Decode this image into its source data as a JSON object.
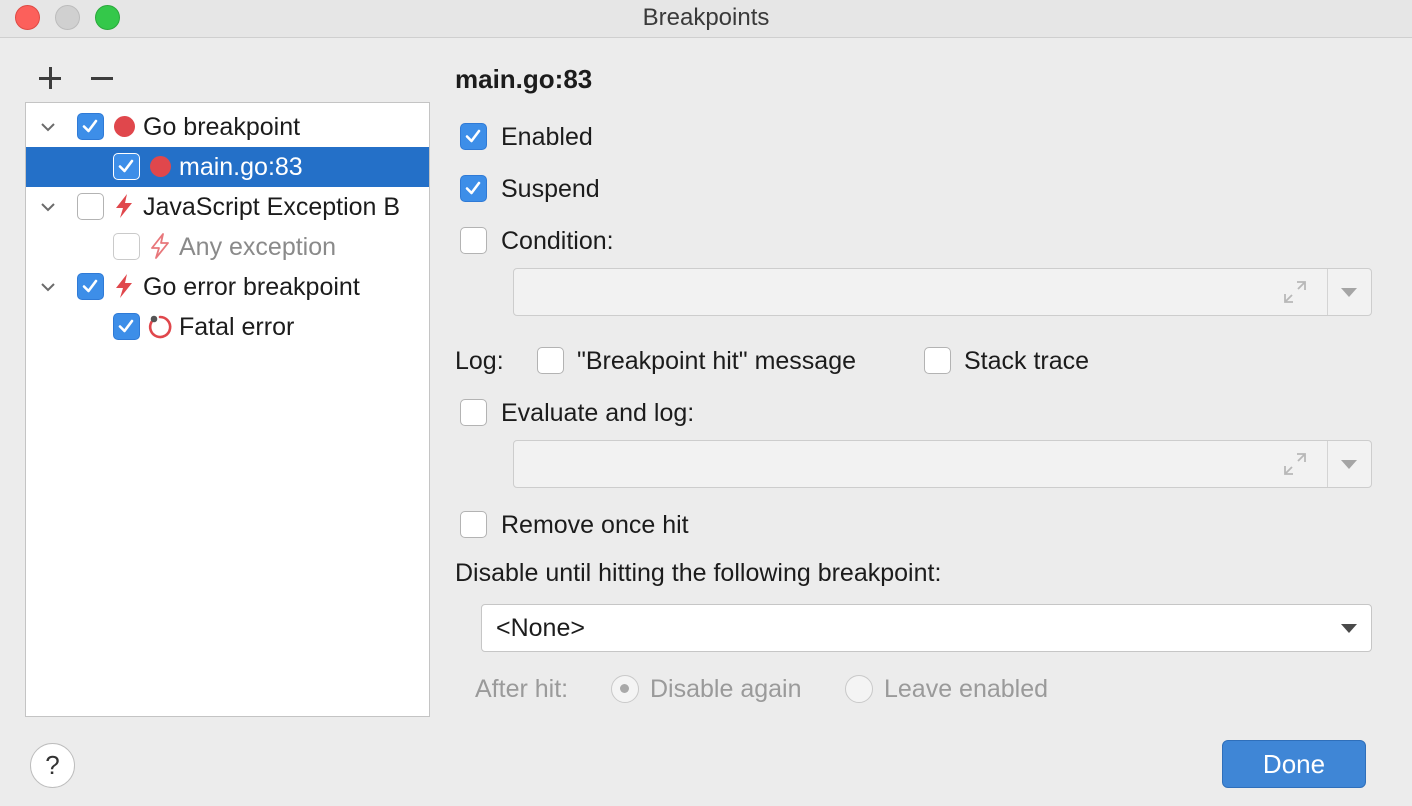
{
  "window": {
    "title": "Breakpoints"
  },
  "toolbar": {
    "add_icon": "plus-icon",
    "remove_icon": "minus-icon"
  },
  "tree": {
    "groups": [
      {
        "label": "Go breakpoint",
        "checked": true,
        "icon": "red-dot-icon",
        "expanded": true,
        "children": [
          {
            "label": "main.go:83",
            "checked": true,
            "icon": "red-dot-icon",
            "selected": true
          }
        ]
      },
      {
        "label": "JavaScript Exception B",
        "checked": false,
        "icon": "lightning-icon",
        "expanded": true,
        "children": [
          {
            "label": "Any exception",
            "checked": false,
            "icon": "lightning-icon",
            "disabled": true
          }
        ]
      },
      {
        "label": "Go error breakpoint",
        "checked": true,
        "icon": "lightning-icon",
        "expanded": true,
        "children": [
          {
            "label": "Fatal error",
            "checked": true,
            "icon": "fatal-error-icon"
          }
        ]
      }
    ]
  },
  "details": {
    "heading": "main.go:83",
    "enabled": {
      "label": "Enabled",
      "checked": true
    },
    "suspend": {
      "label": "Suspend",
      "checked": true
    },
    "condition": {
      "label": "Condition:",
      "checked": false,
      "value": ""
    },
    "log": {
      "label": "Log:",
      "breakpoint_hit": {
        "label": "\"Breakpoint hit\" message",
        "checked": false
      },
      "stack_trace": {
        "label": "Stack trace",
        "checked": false
      }
    },
    "evaluate": {
      "label": "Evaluate and log:",
      "checked": false,
      "value": ""
    },
    "remove_once_hit": {
      "label": "Remove once hit",
      "checked": false
    },
    "disable_until": {
      "label": "Disable until hitting the following breakpoint:",
      "value": "<None>"
    },
    "after_hit": {
      "label": "After hit:",
      "options": [
        {
          "label": "Disable again",
          "selected": true
        },
        {
          "label": "Leave enabled",
          "selected": false
        }
      ]
    }
  },
  "footer": {
    "help_label": "?",
    "done_label": "Done"
  },
  "colors": {
    "accent": "#3d8ee8",
    "selection": "#2470c8",
    "breakpoint_red": "#e0474c"
  }
}
